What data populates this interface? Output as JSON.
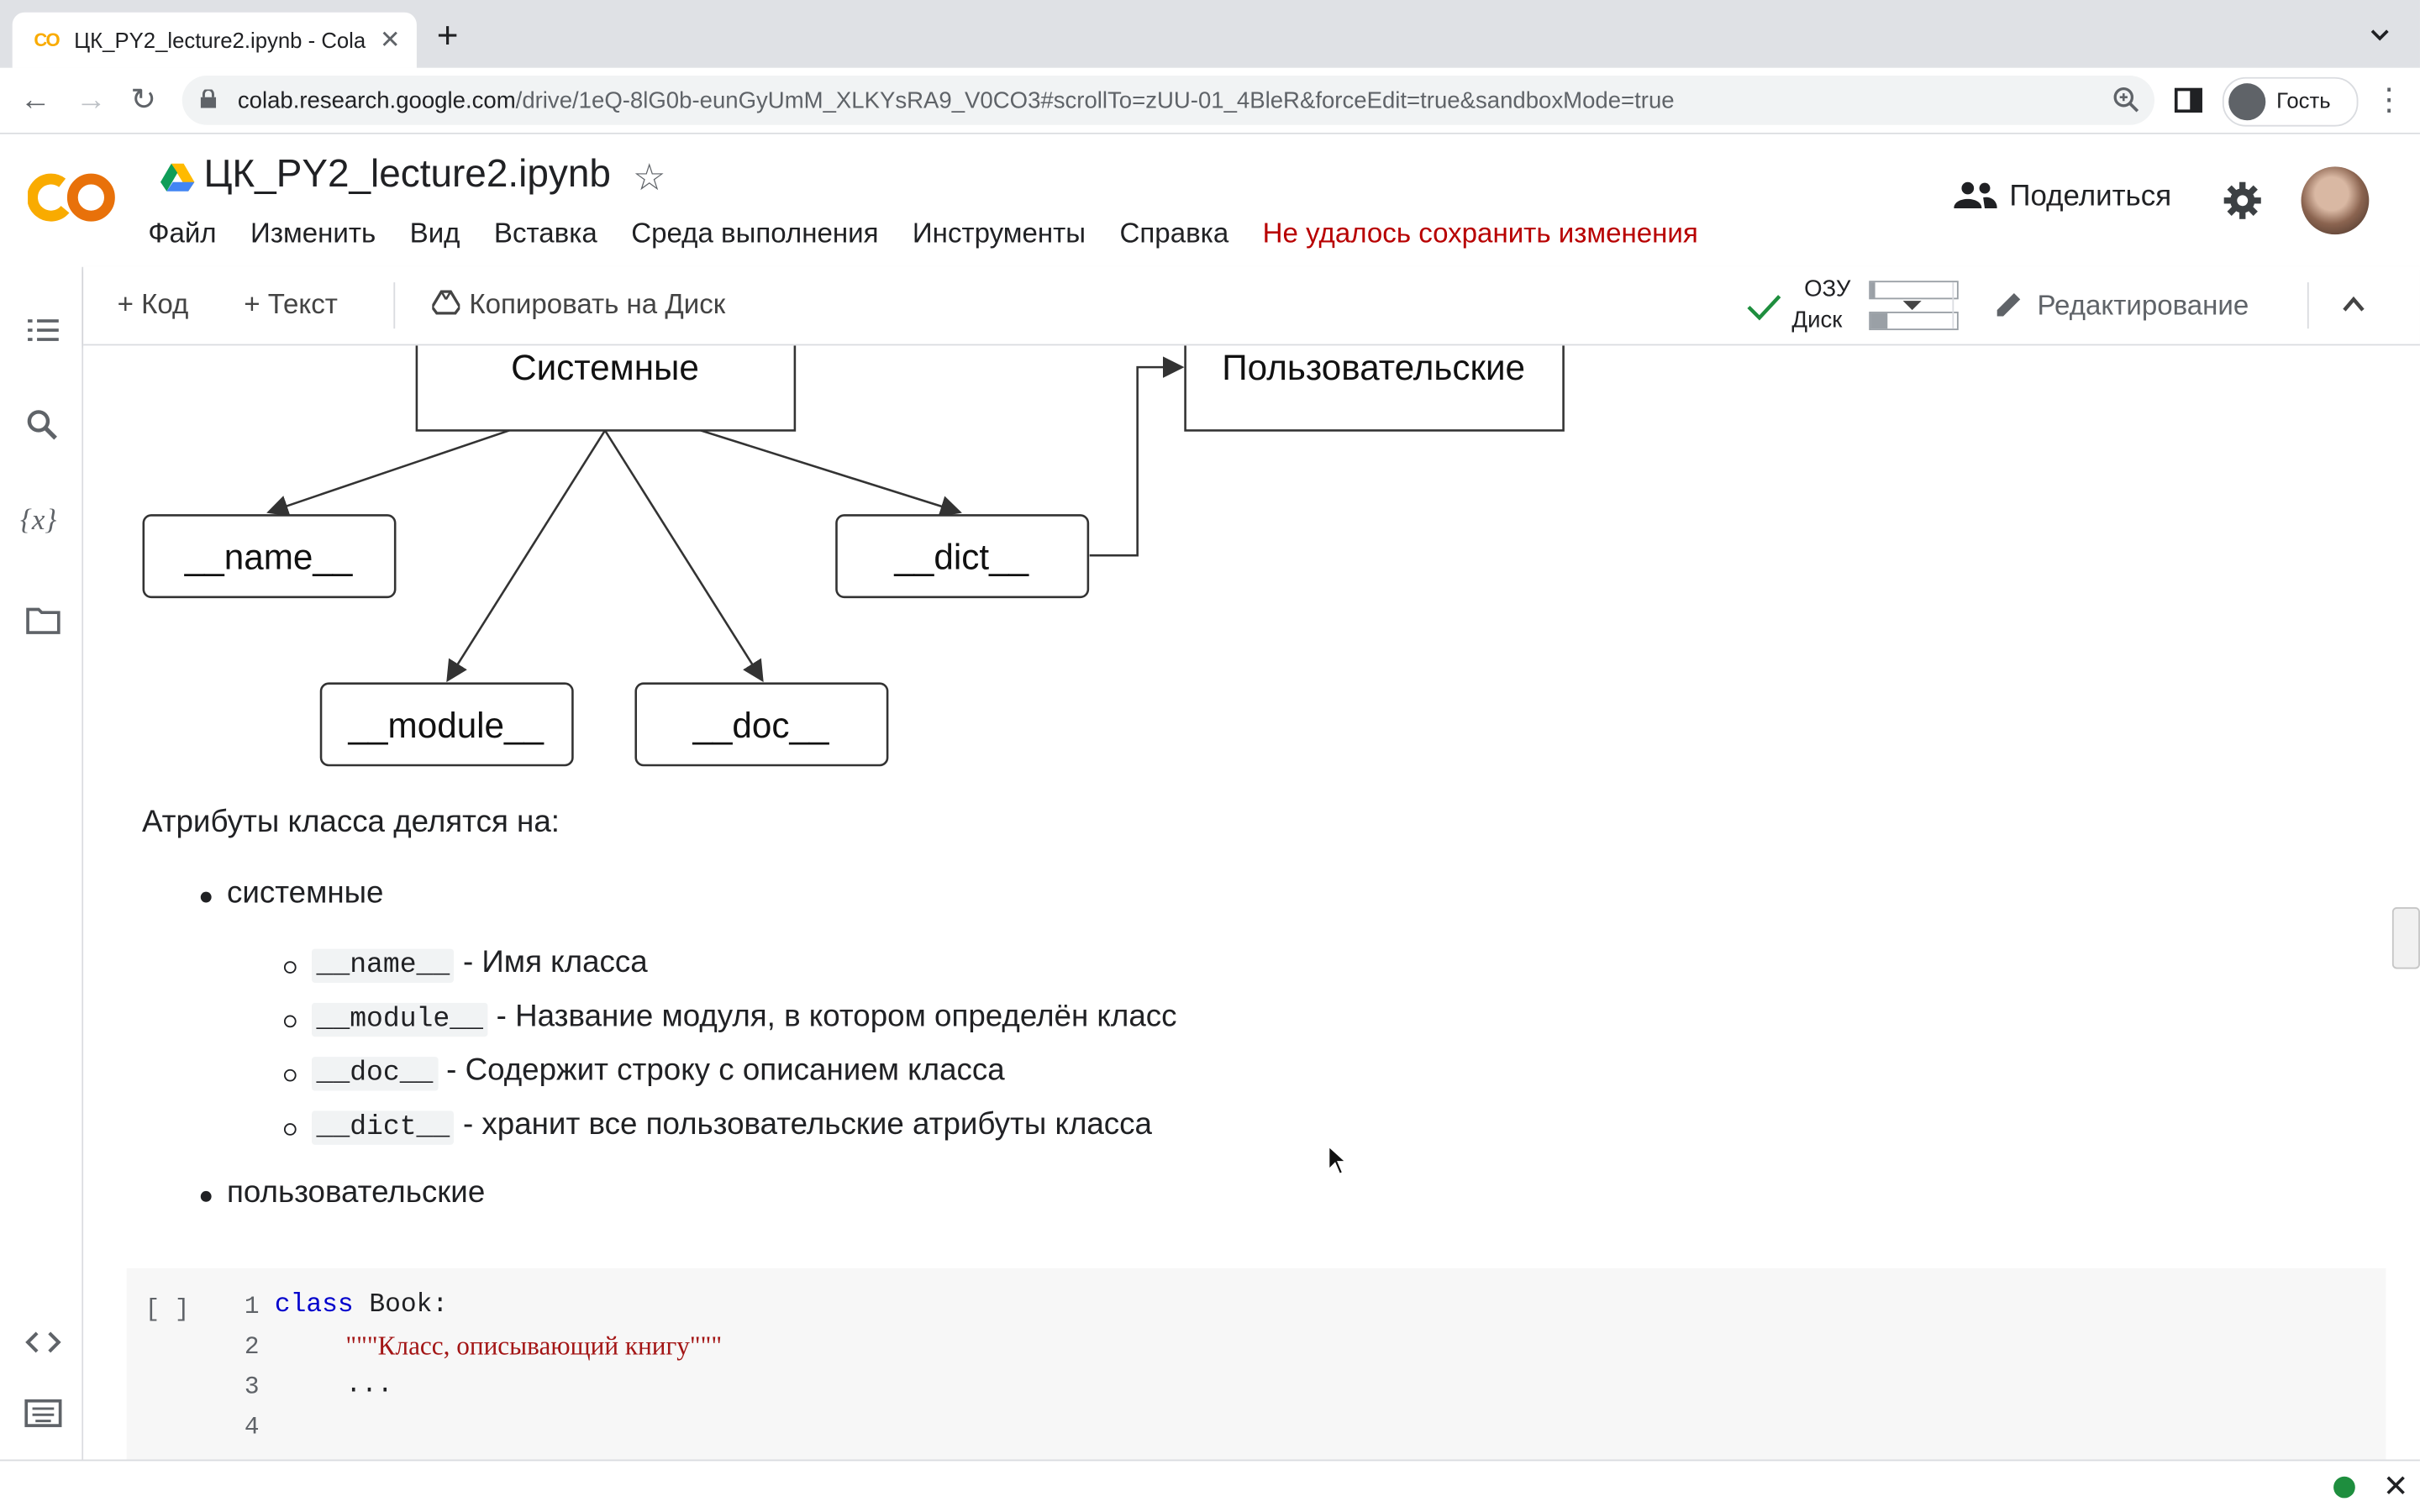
{
  "browser": {
    "tab_title": "ЦК_PY2_lecture2.ipynb - Cola",
    "tab_favicon": "CO",
    "url_host": "colab.research.google.com",
    "url_path": "/drive/1eQ-8lG0b-eunGyUmM_XLKYsRA9_V0CO3#scrollTo=zUU-01_4BleR&forceEdit=true&sandboxMode=true",
    "profile_label": "Гость"
  },
  "colab": {
    "doc_name": "ЦК_PY2_lecture2.ipynb",
    "menu": [
      "Файл",
      "Изменить",
      "Вид",
      "Вставка",
      "Среда выполнения",
      "Инструменты",
      "Справка"
    ],
    "save_error": "Не удалось сохранить изменения",
    "share_label": "Поделиться"
  },
  "toolbar": {
    "add_code": "+ Код",
    "add_text": "+ Текст",
    "copy_to_drive": "Копировать на Диск",
    "ram_label": "ОЗУ",
    "disk_label": "Диск",
    "ram_fill": 0.05,
    "disk_fill": 0.2,
    "edit_mode": "Редактирование"
  },
  "diagram": {
    "root": "Системные",
    "user": "Пользовательские",
    "name": "__name__",
    "dict": "__dict__",
    "module": "__module__",
    "doc": "__doc__"
  },
  "markdown": {
    "intro": "Атрибуты класса делятся на:",
    "system": "системные",
    "items": [
      {
        "code": "__name__",
        "desc": " - Имя класса"
      },
      {
        "code": "__module__",
        "desc": " - Название модуля, в котором определён класс"
      },
      {
        "code": "__doc__",
        "desc": " - Содержит строку с описанием класса"
      },
      {
        "code": "__dict__",
        "desc": " - хранит все пользовательские атрибуты класса"
      }
    ],
    "user": "пользовательские"
  },
  "code_cell": {
    "run_bracket": "[ ]",
    "line_numbers": [
      "1",
      "2",
      "3",
      "4"
    ],
    "line1_kw": "class",
    "line1_rest": " Book:",
    "line2": "\"\"\"Класс, описывающий книгу\"\"\"",
    "line3": "..."
  },
  "colors": {
    "error": "#b80000",
    "keyword": "#0000cc",
    "string": "#a31515",
    "status_ok": "#1e8e3e"
  }
}
